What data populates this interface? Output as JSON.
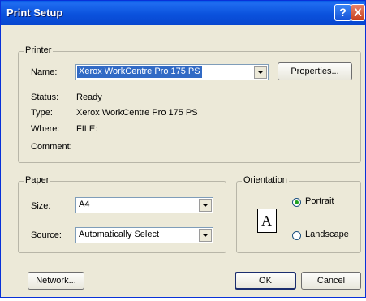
{
  "window": {
    "title": "Print Setup",
    "help_glyph": "?",
    "close_glyph": "X"
  },
  "printer": {
    "legend": "Printer",
    "name_label": "Name:",
    "name_value": "Xerox WorkCentre Pro 175 PS",
    "properties_label": "Properties...",
    "status_label": "Status:",
    "status_value": "Ready",
    "type_label": "Type:",
    "type_value": "Xerox WorkCentre Pro 175 PS",
    "where_label": "Where:",
    "where_value": "FILE:",
    "comment_label": "Comment:",
    "comment_value": ""
  },
  "paper": {
    "legend": "Paper",
    "size_label": "Size:",
    "size_value": "A4",
    "source_label": "Source:",
    "source_value": "Automatically Select"
  },
  "orientation": {
    "legend": "Orientation",
    "icon_letter": "A",
    "portrait_label": "Portrait",
    "landscape_label": "Landscape",
    "selected": "Portrait"
  },
  "buttons": {
    "network": "Network...",
    "ok": "OK",
    "cancel": "Cancel"
  },
  "colors": {
    "title_bar": "#0a5ce8",
    "selection": "#316ac5",
    "dialog_bg": "#ece9d8"
  }
}
